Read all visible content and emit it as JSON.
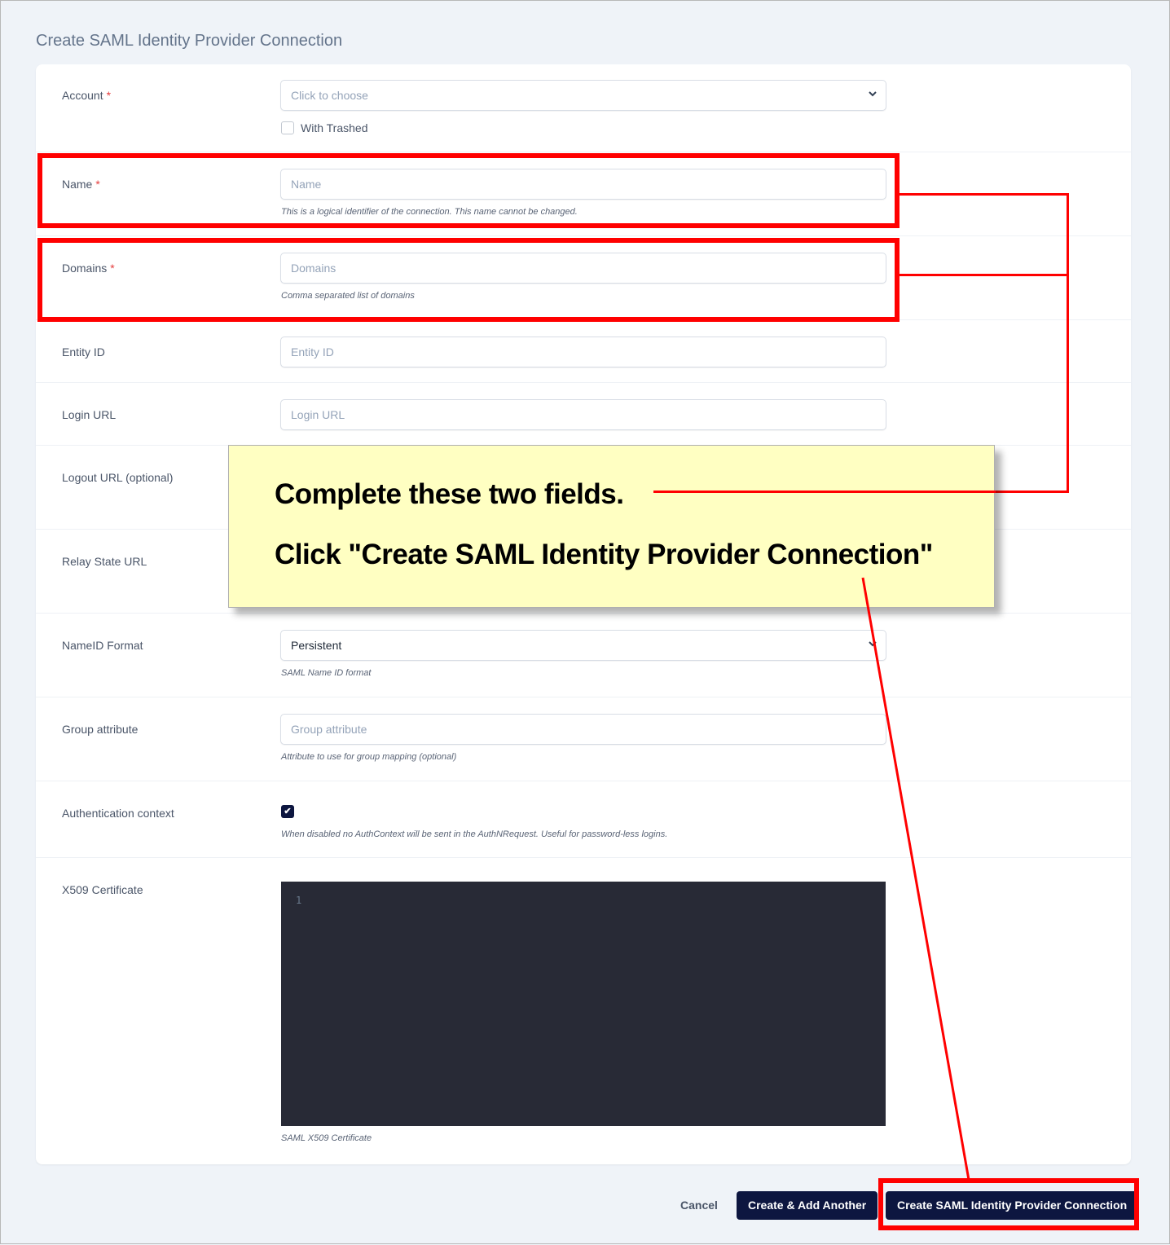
{
  "page": {
    "title": "Create SAML Identity Provider Connection"
  },
  "form": {
    "account": {
      "label": "Account",
      "required_marker": "*",
      "placeholder": "Click to choose",
      "with_trashed_label": "With Trashed",
      "with_trashed_checked": false
    },
    "name": {
      "label": "Name",
      "required_marker": "*",
      "placeholder": "Name",
      "value": "",
      "help": "This is a logical identifier of the connection. This name cannot be changed."
    },
    "domains": {
      "label": "Domains",
      "required_marker": "*",
      "placeholder": "Domains",
      "value": "",
      "help": "Comma separated list of domains"
    },
    "entity_id": {
      "label": "Entity ID",
      "placeholder": "Entity ID",
      "value": ""
    },
    "login_url": {
      "label": "Login URL",
      "placeholder": "Login URL",
      "value": ""
    },
    "logout_url": {
      "label": "Logout URL (optional)"
    },
    "relay_state_url": {
      "label": "Relay State URL"
    },
    "nameid_format": {
      "label": "NameID Format",
      "selected": "Persistent",
      "help": "SAML Name ID format"
    },
    "group_attribute": {
      "label": "Group attribute",
      "placeholder": "Group attribute",
      "value": "",
      "help": "Attribute to use for group mapping (optional)"
    },
    "auth_context": {
      "label": "Authentication context",
      "checked": true,
      "check_glyph": "✔",
      "help": "When disabled no AuthContext will be sent in the AuthNRequest. Useful for password-less logins."
    },
    "x509": {
      "label": "X509 Certificate",
      "line_number": "1",
      "help": "SAML X509 Certificate"
    }
  },
  "footer": {
    "cancel_label": "Cancel",
    "create_another_label": "Create & Add Another",
    "create_label": "Create SAML Identity Provider Connection"
  },
  "annotation": {
    "line1": "Complete these two fields.",
    "line2": "Click \"Create SAML Identity Provider Connection\"",
    "highlight_color": "#ff0000",
    "callout_bg": "#ffffc2"
  },
  "icons": {
    "chevron_down": "⌄"
  }
}
